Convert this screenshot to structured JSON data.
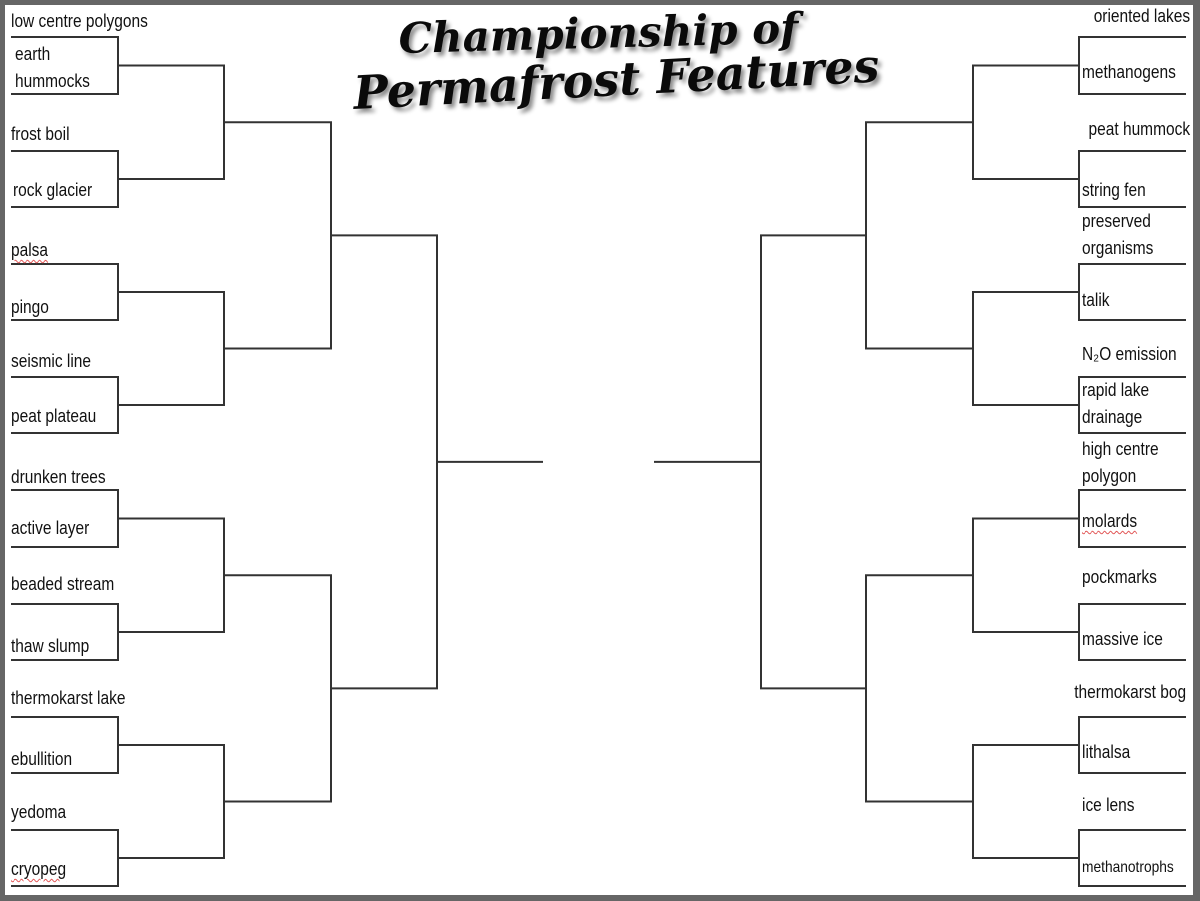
{
  "title": {
    "line1": "Championship of",
    "line2": "Permafrost Features"
  },
  "colors": {
    "frame": "#666666",
    "background": "#ffffff",
    "bracket_line": "#333333",
    "text": "#111111",
    "spellcheck_underline": "#e05050"
  },
  "left_bracket": {
    "matchups": [
      {
        "top": "low centre polygons",
        "bottom": "earth hummocks"
      },
      {
        "top": "frost boil",
        "bottom": "rock glacier"
      },
      {
        "top": "palsa",
        "bottom": "pingo"
      },
      {
        "top": "seismic line",
        "bottom": "peat plateau"
      },
      {
        "top": "drunken trees",
        "bottom": "active layer"
      },
      {
        "top": "beaded stream",
        "bottom": "thaw slump"
      },
      {
        "top": "thermokarst lake",
        "bottom": "ebullition"
      },
      {
        "top": "yedoma",
        "bottom": "cryopeg"
      }
    ]
  },
  "right_bracket": {
    "matchups": [
      {
        "top": "oriented lakes",
        "bottom": "methanogens"
      },
      {
        "top": "peat hummock",
        "bottom": "string fen"
      },
      {
        "top": "preserved organisms",
        "bottom": "talik"
      },
      {
        "top": "N₂O emission",
        "bottom": "rapid lake drainage"
      },
      {
        "top": "high centre polygon",
        "bottom": "molards"
      },
      {
        "top": "pockmarks",
        "bottom": "massive ice"
      },
      {
        "top": "thermokarst bog",
        "bottom": "lithalsa"
      },
      {
        "top": "ice lens",
        "bottom": "methanotrophs"
      }
    ]
  }
}
